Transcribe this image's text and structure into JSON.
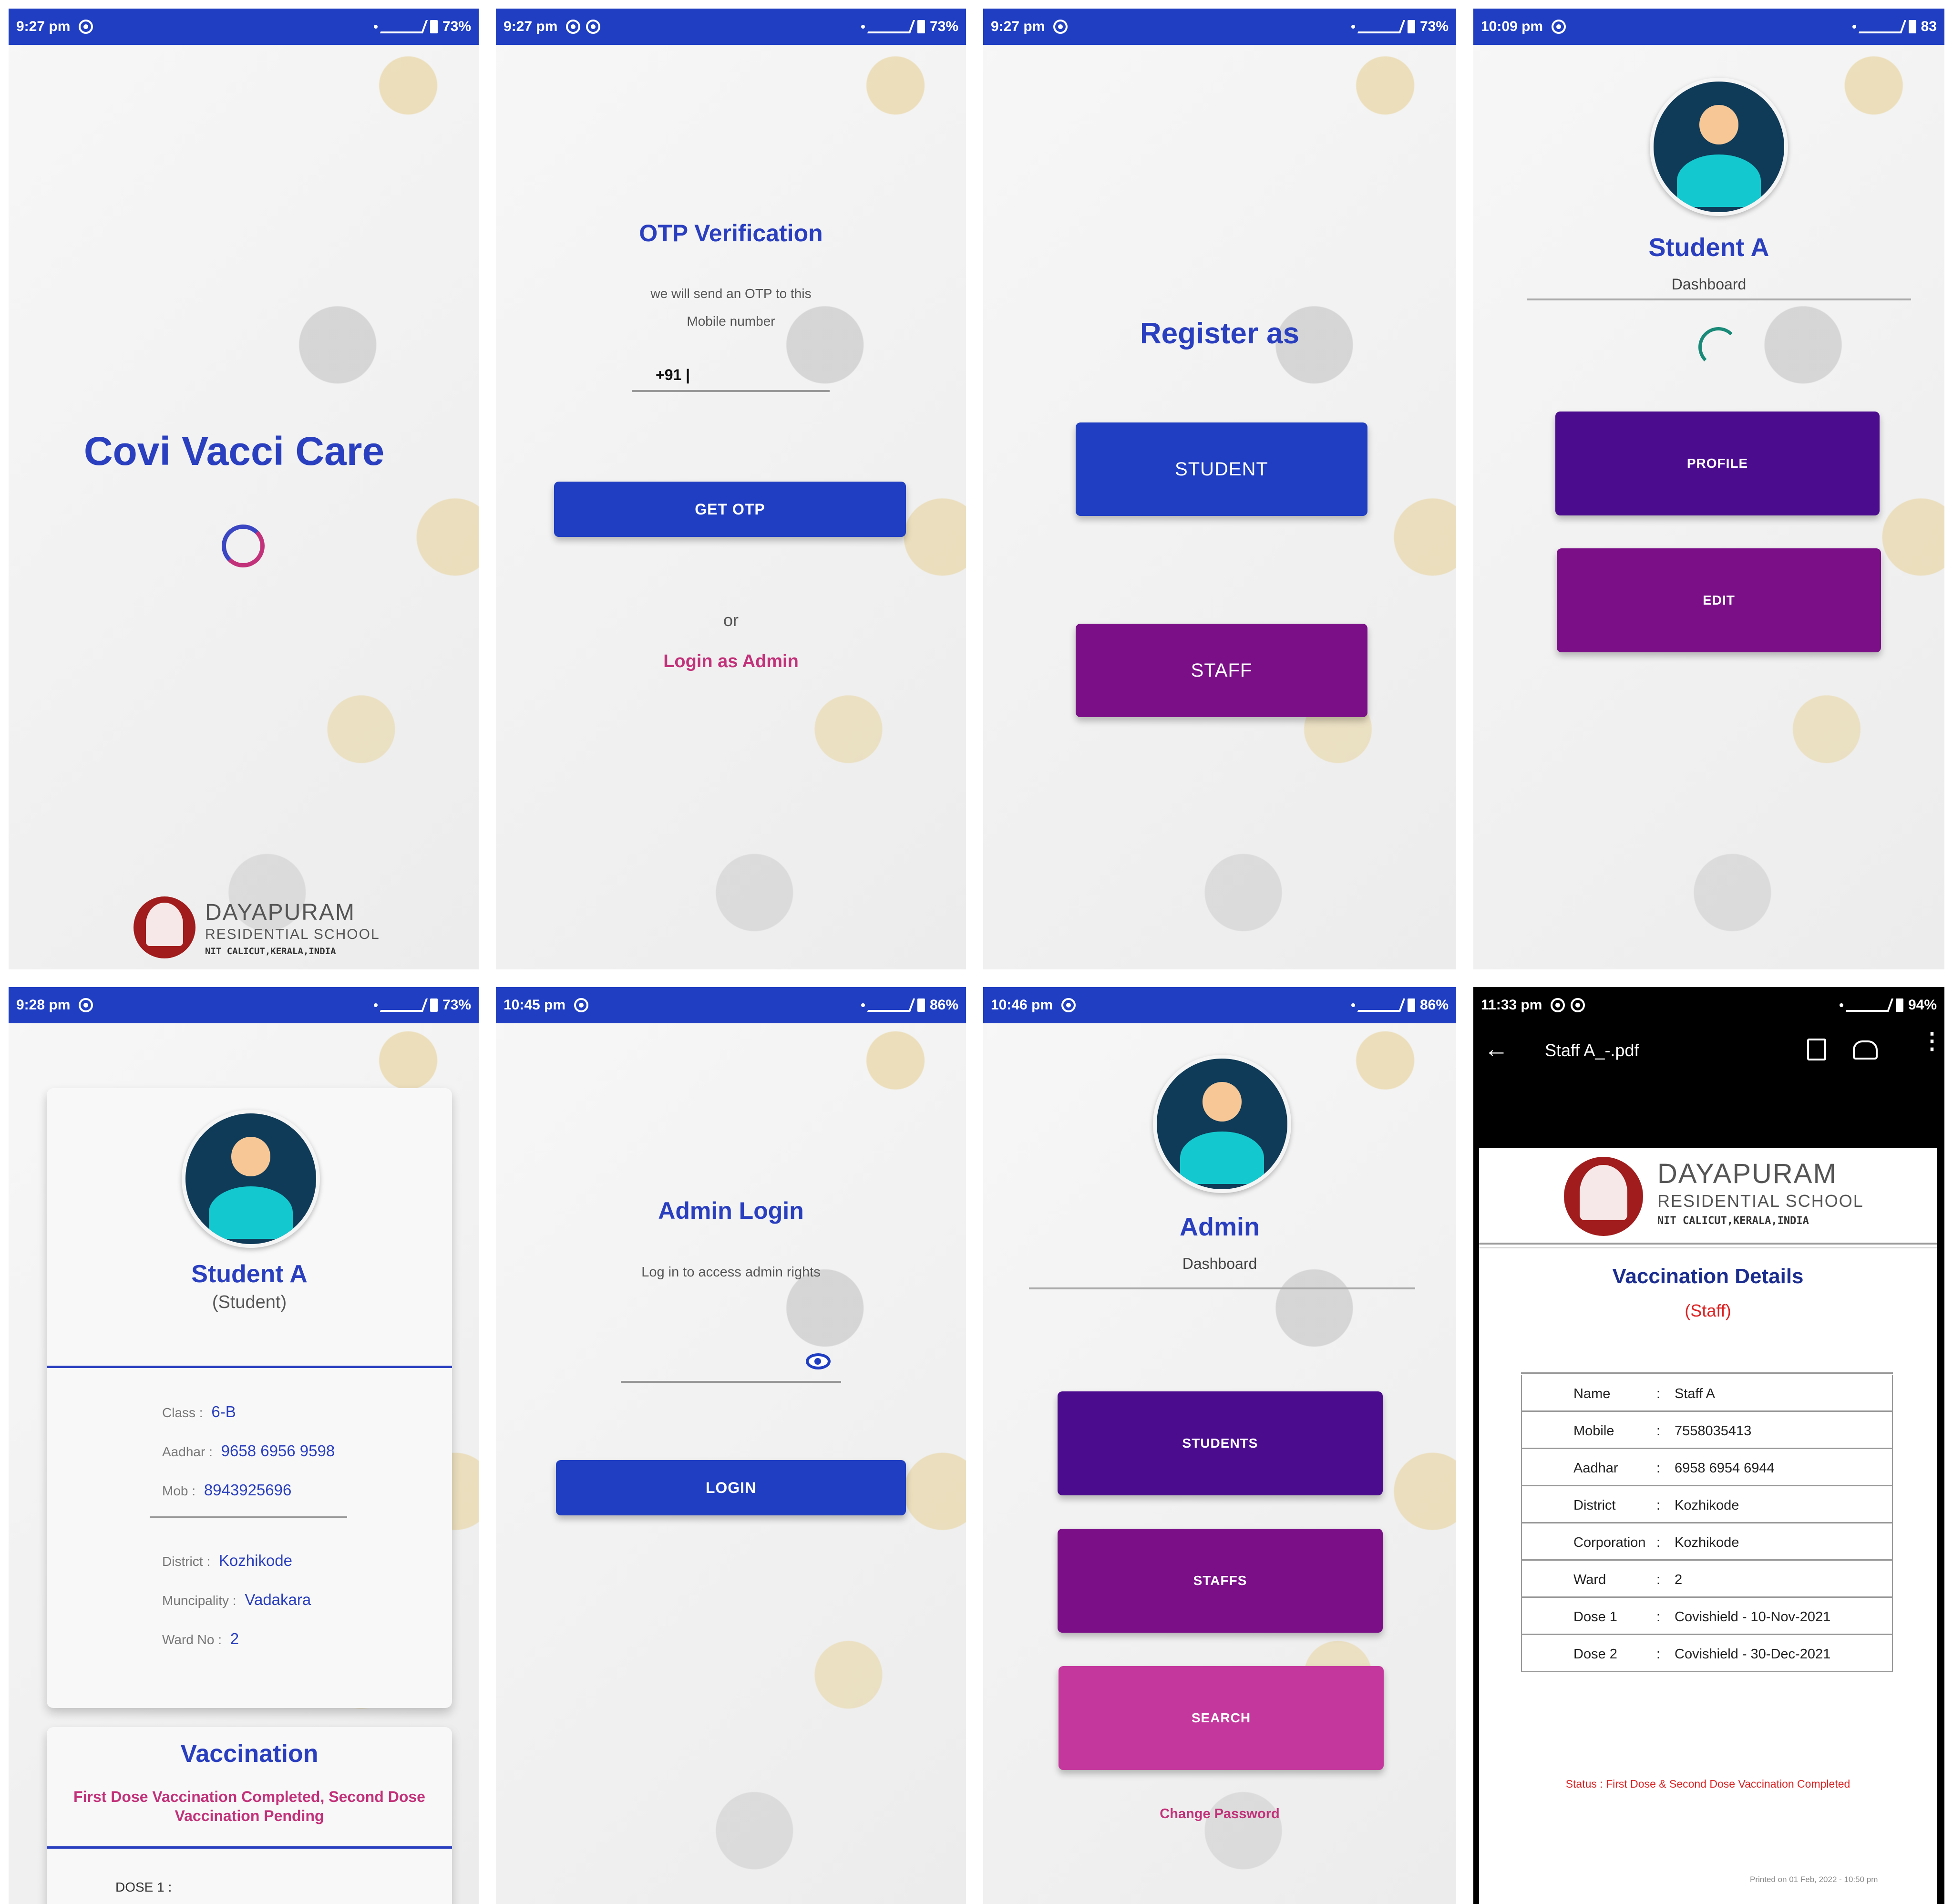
{
  "screens": {
    "s1": {
      "status": {
        "time": "9:27 pm",
        "battery": "73%"
      },
      "title": "Covi Vacci Care",
      "logo": {
        "name": "DAYAPURAM",
        "sub": "RESIDENTIAL SCHOOL",
        "place": "NIT CALICUT,KERALA,INDIA"
      }
    },
    "s2": {
      "status": {
        "time": "9:27 pm",
        "battery": "73%"
      },
      "title": "OTP Verification",
      "desc1": "we will send an OTP to this",
      "desc2": "Mobile number",
      "phone_prefix": "+91 |",
      "get_otp": "GET OTP",
      "or": "or",
      "admin_link": "Login as Admin"
    },
    "s3": {
      "status": {
        "time": "9:27 pm",
        "battery": "73%"
      },
      "title": "Register as",
      "student_btn": "STUDENT",
      "staff_btn": "STAFF"
    },
    "s4": {
      "status": {
        "time": "10:09 pm",
        "battery": "83"
      },
      "name": "Student A",
      "subtitle": "Dashboard",
      "profile_btn": "PROFILE",
      "edit_btn": "EDIT"
    },
    "s5": {
      "status": {
        "time": "9:28 pm",
        "battery": "73%"
      },
      "name": "Student A",
      "role": "(Student)",
      "fields": [
        {
          "label": "Class :",
          "value": "6-B"
        },
        {
          "label": "Aadhar :",
          "value": "9658 6956 9598"
        },
        {
          "label": "Mob :",
          "value": "8943925696"
        },
        {
          "label": "District :",
          "value": "Kozhikode"
        },
        {
          "label": "Muncipality :",
          "value": "Vadakara"
        },
        {
          "label": "Ward No :",
          "value": "2"
        }
      ],
      "vacc_title": "Vaccination",
      "vacc_status": "First Dose Vaccination Completed, Second Dose Vaccination Pending",
      "dose1": "DOSE 1 :"
    },
    "s6": {
      "status": {
        "time": "10:45 pm",
        "battery": "86%"
      },
      "title": "Admin Login",
      "desc": "Log in to access admin rights",
      "login_btn": "LOGIN"
    },
    "s7": {
      "status": {
        "time": "10:46 pm",
        "battery": "86%"
      },
      "name": "Admin",
      "subtitle": "Dashboard",
      "students_btn": "STUDENTS",
      "staffs_btn": "STAFFS",
      "search_btn": "SEARCH",
      "change_pw": "Change Password"
    },
    "s8": {
      "status": {
        "time": "11:33 pm",
        "battery": "94%"
      },
      "filename": "Staff A_-.pdf",
      "logo": {
        "name": "DAYAPURAM",
        "sub": "RESIDENTIAL SCHOOL",
        "place": "NIT CALICUT,KERALA,INDIA"
      },
      "heading": "Vaccination Details",
      "sub": "(Staff)",
      "rows": [
        {
          "label": "Name",
          "value": "Staff A"
        },
        {
          "label": "Mobile",
          "value": "7558035413"
        },
        {
          "label": "Aadhar",
          "value": "6958 6954 6944"
        },
        {
          "label": "District",
          "value": "Kozhikode"
        },
        {
          "label": "Corporation",
          "value": "Kozhikode"
        },
        {
          "label": "Ward",
          "value": "2"
        },
        {
          "label": "Dose 1",
          "value": "Covishield - 10-Nov-2021"
        },
        {
          "label": "Dose 2",
          "value": "Covishield - 30-Dec-2021"
        }
      ],
      "sep": ":",
      "status_line": "Status : First Dose & Second Dose Vaccination Completed",
      "printed": "Printed on 01 Feb, 2022 - 10:50 pm"
    }
  }
}
